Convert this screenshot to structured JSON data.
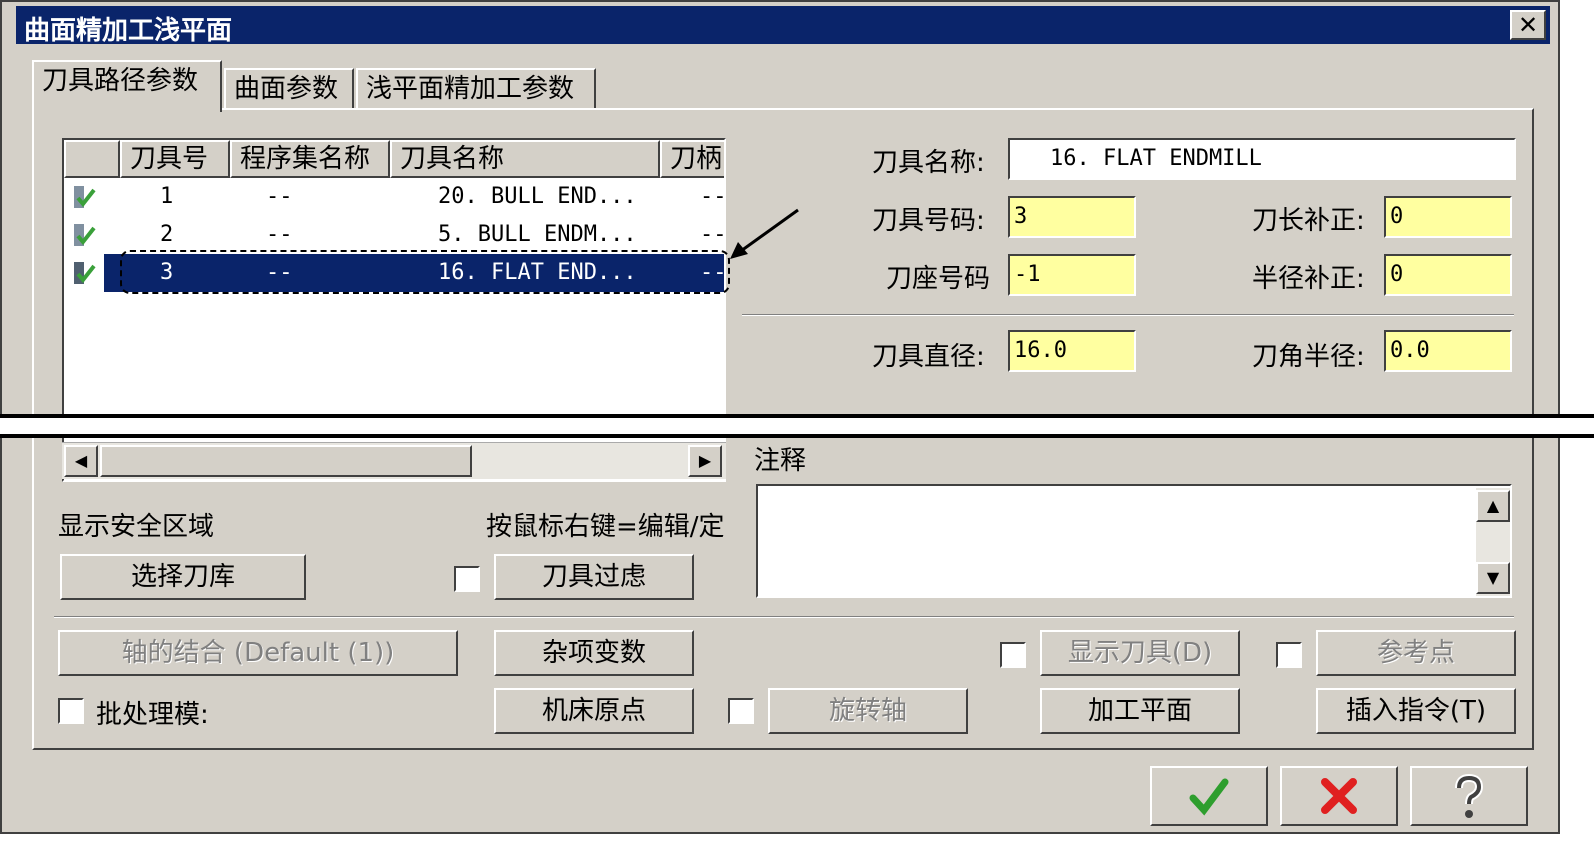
{
  "window": {
    "title": "曲面精加工浅平面"
  },
  "tabs": [
    {
      "label": "刀具路径参数"
    },
    {
      "label": "曲面参数"
    },
    {
      "label": "浅平面精加工参数"
    }
  ],
  "tool_list": {
    "columns": [
      "刀具号",
      "程序集名称",
      "刀具名称",
      "刀柄"
    ],
    "rows": [
      {
        "num": "1",
        "group": "--",
        "name": "20. BULL END...",
        "holder": "--"
      },
      {
        "num": "2",
        "group": "--",
        "name": "5. BULL ENDM...",
        "holder": "--"
      },
      {
        "num": "3",
        "group": "--",
        "name": "16. FLAT END...",
        "holder": "--"
      }
    ]
  },
  "tool_params": {
    "tool_name_label": "刀具名称:",
    "tool_name_value": "16. FLAT ENDMILL",
    "tool_number_label": "刀具号码:",
    "tool_number_value": "3",
    "length_offset_label": "刀长补正:",
    "length_offset_value": "0",
    "holder_number_label": "刀座号码",
    "holder_number_value": "-1",
    "radius_offset_label": "半径补正:",
    "radius_offset_value": "0",
    "diameter_label": "刀具直径:",
    "diameter_value": "16.0",
    "corner_radius_label": "刀角半径:",
    "corner_radius_value": "0.0"
  },
  "comment": {
    "label": "注释"
  },
  "left_controls": {
    "show_safe_zone": "显示安全区域",
    "right_click_hint": "按鼠标右键=编辑/定",
    "select_library": "选择刀库",
    "tool_filter": "刀具过虑"
  },
  "bottom_controls": {
    "axis_combo": "轴的结合 (Default (1))",
    "misc_values": "杂项变数",
    "show_tool": "显示刀具(D)",
    "reference_point": "参考点",
    "batch_mode": "批处理模:",
    "machine_origin": "机床原点",
    "rotary_axis": "旋转轴",
    "work_plane": "加工平面",
    "insert_command": "插入指令(T)"
  },
  "colors": {
    "title_bar": "#0a246a",
    "dialog_bg": "#d4d0c8",
    "field_yellow": "#ffffa0",
    "ok_green": "#2e9e2e",
    "cancel_red": "#e02020"
  },
  "icons": [
    "close-icon",
    "check-icon",
    "ok-check-icon",
    "cancel-x-icon",
    "help-question-icon",
    "scroll-left-icon",
    "scroll-right-icon",
    "scroll-up-icon",
    "scroll-down-icon"
  ]
}
